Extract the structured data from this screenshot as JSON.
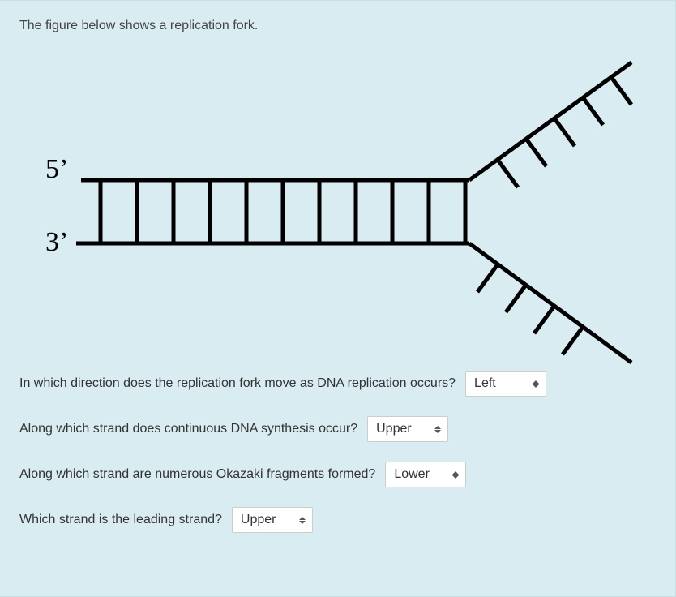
{
  "intro": "The figure below shows a replication fork.",
  "labels": {
    "five_prime": "5’",
    "three_prime": "3’"
  },
  "questions": [
    {
      "text": "In which direction does the replication fork move as DNA replication occurs?",
      "selected": "Left"
    },
    {
      "text": "Along which strand does continuous DNA synthesis occur?",
      "selected": "Upper"
    },
    {
      "text": "Along which strand are numerous Okazaki fragments formed?",
      "selected": "Lower"
    },
    {
      "text": "Which strand is the leading strand?",
      "selected": "Upper"
    }
  ]
}
